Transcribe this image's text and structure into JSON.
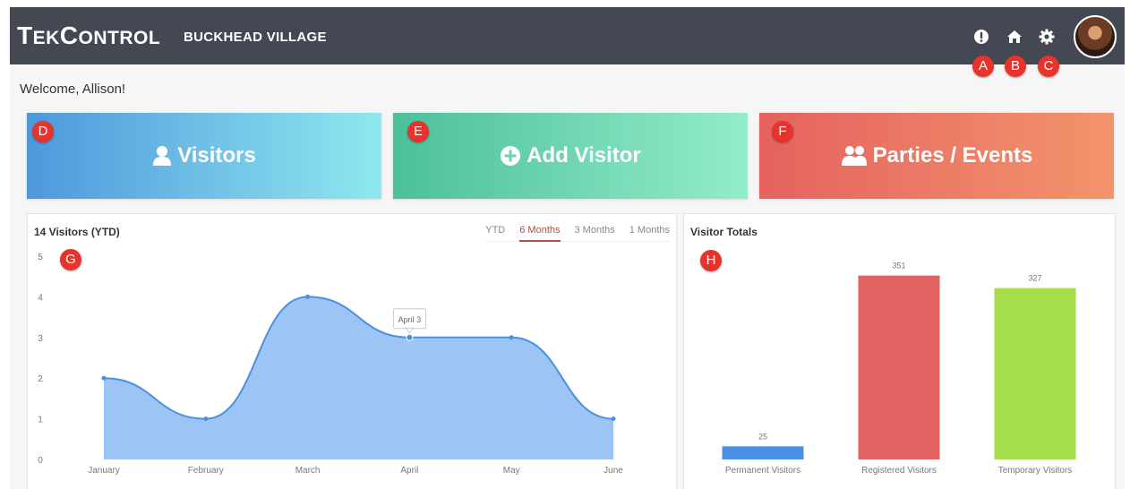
{
  "header": {
    "brand_big_t": "T",
    "brand_small_ek": "EK",
    "brand_big_c": "C",
    "brand_small_ontrol": "ONTROL",
    "community": "BUCKHEAD VILLAGE",
    "icons": [
      "alert-icon",
      "home-icon",
      "gear-icon"
    ],
    "avatar": "user-avatar"
  },
  "welcome": "Welcome, Allison!",
  "tiles": [
    {
      "label": "Visitors",
      "icon": "user-icon",
      "marker": "D"
    },
    {
      "label": "Add Visitor",
      "icon": "plus-circle-icon",
      "marker": "E"
    },
    {
      "label": "Parties / Events",
      "icon": "users-icon",
      "marker": "F"
    }
  ],
  "markers": {
    "a": "A",
    "b": "B",
    "c": "C",
    "d": "D",
    "e": "E",
    "f": "F",
    "g": "G",
    "h": "H"
  },
  "visitors_panel": {
    "title": "14 Visitors (YTD)",
    "tabs": [
      "YTD",
      "6 Months",
      "3 Months",
      "1 Months"
    ],
    "active_tab": "6 Months"
  },
  "totals_panel": {
    "title": "Visitor Totals"
  },
  "chart_data": [
    {
      "type": "area",
      "categories": [
        "January",
        "February",
        "March",
        "April",
        "May",
        "June"
      ],
      "values": [
        2,
        1,
        4,
        3,
        3,
        1
      ],
      "ylim": [
        0,
        5
      ],
      "yticks": [
        "0",
        "1",
        "2",
        "3",
        "4",
        "5"
      ],
      "tooltip": "April 3",
      "color": "#4a90e2",
      "fill": "#9cc4f4",
      "grid": false
    },
    {
      "type": "bar",
      "categories": [
        "Permanent Visitors",
        "Registered Visitors",
        "Temporary Visitors"
      ],
      "values": [
        25,
        351,
        327
      ],
      "value_labels": [
        "25",
        "351",
        "327"
      ],
      "colors": [
        "#4a90e2",
        "#e06262",
        "#a6dd4b"
      ],
      "ylim": [
        0,
        400
      ]
    }
  ]
}
